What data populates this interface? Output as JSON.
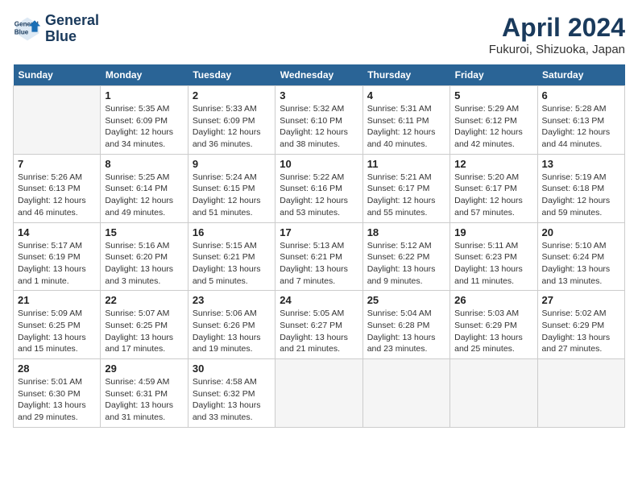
{
  "logo": {
    "line1": "General",
    "line2": "Blue"
  },
  "title": "April 2024",
  "location": "Fukuroi, Shizuoka, Japan",
  "headers": [
    "Sunday",
    "Monday",
    "Tuesday",
    "Wednesday",
    "Thursday",
    "Friday",
    "Saturday"
  ],
  "weeks": [
    [
      {
        "num": "",
        "info": ""
      },
      {
        "num": "1",
        "info": "Sunrise: 5:35 AM\nSunset: 6:09 PM\nDaylight: 12 hours\nand 34 minutes."
      },
      {
        "num": "2",
        "info": "Sunrise: 5:33 AM\nSunset: 6:09 PM\nDaylight: 12 hours\nand 36 minutes."
      },
      {
        "num": "3",
        "info": "Sunrise: 5:32 AM\nSunset: 6:10 PM\nDaylight: 12 hours\nand 38 minutes."
      },
      {
        "num": "4",
        "info": "Sunrise: 5:31 AM\nSunset: 6:11 PM\nDaylight: 12 hours\nand 40 minutes."
      },
      {
        "num": "5",
        "info": "Sunrise: 5:29 AM\nSunset: 6:12 PM\nDaylight: 12 hours\nand 42 minutes."
      },
      {
        "num": "6",
        "info": "Sunrise: 5:28 AM\nSunset: 6:13 PM\nDaylight: 12 hours\nand 44 minutes."
      }
    ],
    [
      {
        "num": "7",
        "info": "Sunrise: 5:26 AM\nSunset: 6:13 PM\nDaylight: 12 hours\nand 46 minutes."
      },
      {
        "num": "8",
        "info": "Sunrise: 5:25 AM\nSunset: 6:14 PM\nDaylight: 12 hours\nand 49 minutes."
      },
      {
        "num": "9",
        "info": "Sunrise: 5:24 AM\nSunset: 6:15 PM\nDaylight: 12 hours\nand 51 minutes."
      },
      {
        "num": "10",
        "info": "Sunrise: 5:22 AM\nSunset: 6:16 PM\nDaylight: 12 hours\nand 53 minutes."
      },
      {
        "num": "11",
        "info": "Sunrise: 5:21 AM\nSunset: 6:17 PM\nDaylight: 12 hours\nand 55 minutes."
      },
      {
        "num": "12",
        "info": "Sunrise: 5:20 AM\nSunset: 6:17 PM\nDaylight: 12 hours\nand 57 minutes."
      },
      {
        "num": "13",
        "info": "Sunrise: 5:19 AM\nSunset: 6:18 PM\nDaylight: 12 hours\nand 59 minutes."
      }
    ],
    [
      {
        "num": "14",
        "info": "Sunrise: 5:17 AM\nSunset: 6:19 PM\nDaylight: 13 hours\nand 1 minute."
      },
      {
        "num": "15",
        "info": "Sunrise: 5:16 AM\nSunset: 6:20 PM\nDaylight: 13 hours\nand 3 minutes."
      },
      {
        "num": "16",
        "info": "Sunrise: 5:15 AM\nSunset: 6:21 PM\nDaylight: 13 hours\nand 5 minutes."
      },
      {
        "num": "17",
        "info": "Sunrise: 5:13 AM\nSunset: 6:21 PM\nDaylight: 13 hours\nand 7 minutes."
      },
      {
        "num": "18",
        "info": "Sunrise: 5:12 AM\nSunset: 6:22 PM\nDaylight: 13 hours\nand 9 minutes."
      },
      {
        "num": "19",
        "info": "Sunrise: 5:11 AM\nSunset: 6:23 PM\nDaylight: 13 hours\nand 11 minutes."
      },
      {
        "num": "20",
        "info": "Sunrise: 5:10 AM\nSunset: 6:24 PM\nDaylight: 13 hours\nand 13 minutes."
      }
    ],
    [
      {
        "num": "21",
        "info": "Sunrise: 5:09 AM\nSunset: 6:25 PM\nDaylight: 13 hours\nand 15 minutes."
      },
      {
        "num": "22",
        "info": "Sunrise: 5:07 AM\nSunset: 6:25 PM\nDaylight: 13 hours\nand 17 minutes."
      },
      {
        "num": "23",
        "info": "Sunrise: 5:06 AM\nSunset: 6:26 PM\nDaylight: 13 hours\nand 19 minutes."
      },
      {
        "num": "24",
        "info": "Sunrise: 5:05 AM\nSunset: 6:27 PM\nDaylight: 13 hours\nand 21 minutes."
      },
      {
        "num": "25",
        "info": "Sunrise: 5:04 AM\nSunset: 6:28 PM\nDaylight: 13 hours\nand 23 minutes."
      },
      {
        "num": "26",
        "info": "Sunrise: 5:03 AM\nSunset: 6:29 PM\nDaylight: 13 hours\nand 25 minutes."
      },
      {
        "num": "27",
        "info": "Sunrise: 5:02 AM\nSunset: 6:29 PM\nDaylight: 13 hours\nand 27 minutes."
      }
    ],
    [
      {
        "num": "28",
        "info": "Sunrise: 5:01 AM\nSunset: 6:30 PM\nDaylight: 13 hours\nand 29 minutes."
      },
      {
        "num": "29",
        "info": "Sunrise: 4:59 AM\nSunset: 6:31 PM\nDaylight: 13 hours\nand 31 minutes."
      },
      {
        "num": "30",
        "info": "Sunrise: 4:58 AM\nSunset: 6:32 PM\nDaylight: 13 hours\nand 33 minutes."
      },
      {
        "num": "",
        "info": ""
      },
      {
        "num": "",
        "info": ""
      },
      {
        "num": "",
        "info": ""
      },
      {
        "num": "",
        "info": ""
      }
    ]
  ]
}
